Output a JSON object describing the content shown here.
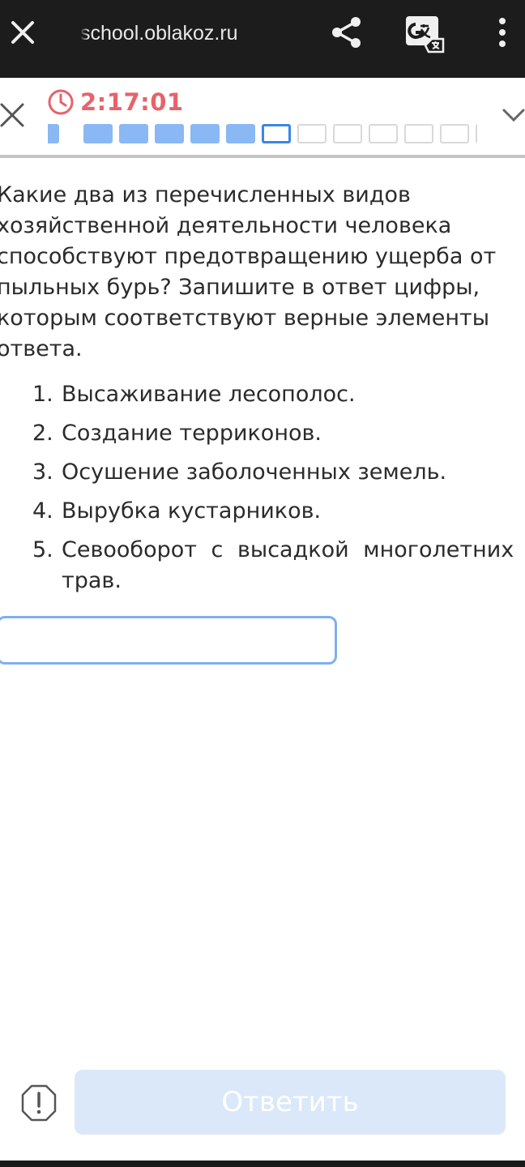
{
  "browser": {
    "url": "school.oblakoz.ru",
    "icons": [
      "close-icon",
      "share-icon",
      "translate-icon",
      "more-vertical-icon"
    ]
  },
  "quiz": {
    "timer": "2:17:01",
    "progress": {
      "total_visible": 13,
      "completed": 6,
      "current_index": 6
    },
    "colors": {
      "timer": "#e8626a",
      "done": "#8ab8f5",
      "current": "#3a86e8",
      "submit_bg": "#dbe8fa"
    }
  },
  "question": {
    "lines": [
      "Какие два из перечисленных видов",
      "хозяйственной деятельности человека",
      "способствуют предотвращению ущерба от",
      "пыльных бурь? Запишите в ответ цифры,",
      "которым соответствуют верные элементы",
      "ответа."
    ],
    "options": [
      {
        "num": "1.",
        "text": "Высаживание лесополос."
      },
      {
        "num": "2.",
        "text": "Создание терриконов."
      },
      {
        "num": "3.",
        "text": "Осушение заболоченных земель."
      },
      {
        "num": "4.",
        "text": "Вырубка кустарников."
      },
      {
        "num": "5.",
        "text": "Севооборот с высадкой многолетних трав."
      }
    ]
  },
  "answer": {
    "value": "",
    "placeholder": ""
  },
  "footer": {
    "submit_label": "Ответить",
    "report_icon": "alert-octagon-icon"
  }
}
